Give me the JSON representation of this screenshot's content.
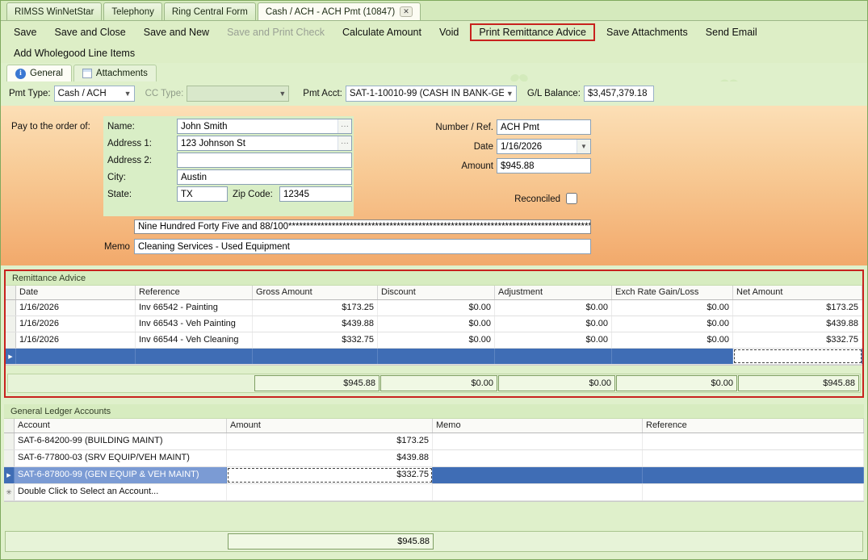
{
  "doc_tabs": {
    "tab1": "RIMSS WinNetStar",
    "tab2": "Telephony",
    "tab3": "Ring Central Form",
    "active_tab": "Cash / ACH - ACH Pmt (10847)"
  },
  "toolbar": {
    "save": "Save",
    "save_and_close": "Save and Close",
    "save_and_new": "Save and New",
    "save_and_print_check": "Save and Print Check",
    "calculate_amount": "Calculate Amount",
    "void": "Void",
    "print_remittance_advice": "Print Remittance Advice",
    "save_attachments": "Save Attachments",
    "send_email": "Send Email",
    "add_wholegood_line_items": "Add Wholegood Line Items"
  },
  "form_tabs": {
    "general": "General",
    "attachments": "Attachments"
  },
  "payment_row": {
    "pmt_type_label": "Pmt Type:",
    "pmt_type_value": "Cash / ACH",
    "cc_type_label": "CC Type:",
    "cc_type_value": "",
    "pmt_acct_label": "Pmt Acct:",
    "pmt_acct_value": "SAT-1-10010-99 (CASH IN BANK-GE...",
    "gl_balance_label": "G/L Balance:",
    "gl_balance_value": "$3,457,379.18"
  },
  "check": {
    "pay_to_label": "Pay to the order of:",
    "name_label": "Name:",
    "name_value": "John Smith",
    "address1_label": "Address 1:",
    "address1_value": "123 Johnson St",
    "address2_label": "Address 2:",
    "address2_value": "",
    "city_label": "City:",
    "city_value": "Austin",
    "state_label": "State:",
    "state_value": "TX",
    "zip_label": "Zip Code:",
    "zip_value": "12345",
    "number_ref_label": "Number / Ref.",
    "number_ref_value": "ACH Pmt",
    "date_label": "Date",
    "date_value": "1/16/2026",
    "amount_label": "Amount",
    "amount_value": "$945.88",
    "reconciled_label": "Reconciled",
    "amount_words": "Nine Hundred Forty Five and 88/100****************************************************************************************",
    "memo_label": "Memo",
    "memo_value": "Cleaning Services - Used Equipment"
  },
  "remittance": {
    "title": "Remittance Advice",
    "columns": [
      "Date",
      "Reference",
      "Gross Amount",
      "Discount",
      "Adjustment",
      "Exch Rate Gain/Loss",
      "Net Amount"
    ],
    "rows": [
      [
        "1/16/2026",
        "Inv 66542 - Painting",
        "$173.25",
        "$0.00",
        "$0.00",
        "$0.00",
        "$173.25"
      ],
      [
        "1/16/2026",
        "Inv 66543 - Veh Painting",
        "$439.88",
        "$0.00",
        "$0.00",
        "$0.00",
        "$439.88"
      ],
      [
        "1/16/2026",
        "Inv 66544 - Veh Cleaning",
        "$332.75",
        "$0.00",
        "$0.00",
        "$0.00",
        "$332.75"
      ]
    ],
    "totals": {
      "gross": "$945.88",
      "discount": "$0.00",
      "adjustment": "$0.00",
      "exch": "$0.00",
      "net": "$945.88"
    }
  },
  "gl": {
    "title": "General Ledger Accounts",
    "columns": [
      "Account",
      "Amount",
      "Memo",
      "Reference"
    ],
    "rows": [
      [
        "SAT-6-84200-99 (BUILDING MAINT)",
        "$173.25",
        "",
        ""
      ],
      [
        "SAT-6-77800-03 (SRV EQUIP/VEH MAINT)",
        "$439.88",
        "",
        ""
      ],
      [
        "SAT-6-87800-99 (GEN EQUIP & VEH MAINT)",
        "$332.75",
        "",
        ""
      ],
      [
        "Double Click to Select an Account...",
        "",
        "",
        ""
      ]
    ],
    "total": "$945.88"
  },
  "colors": {
    "highlight_red": "#c8221e",
    "selection_blue": "#3f6db5",
    "background_green": "#dff0cb",
    "check_orange": "#f2a96b"
  }
}
